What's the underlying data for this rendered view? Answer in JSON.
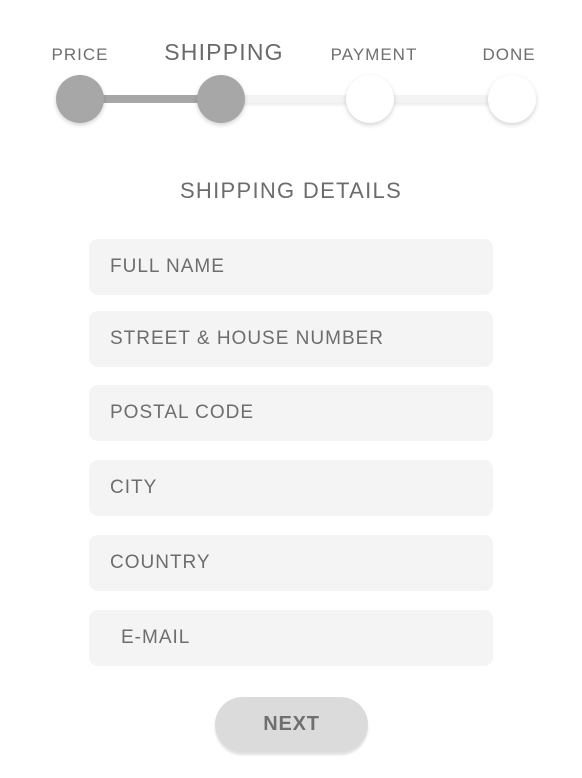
{
  "stepper": {
    "steps": [
      {
        "label": "PRICE",
        "state": "done"
      },
      {
        "label": "SHIPPING",
        "state": "current"
      },
      {
        "label": "PAYMENT",
        "state": "todo"
      },
      {
        "label": "DONE",
        "state": "todo"
      }
    ]
  },
  "form": {
    "title": "SHIPPING DETAILS",
    "fields": [
      {
        "placeholder": "FULL NAME"
      },
      {
        "placeholder": "STREET & HOUSE NUMBER"
      },
      {
        "placeholder": "POSTAL CODE"
      },
      {
        "placeholder": "CITY"
      },
      {
        "placeholder": "COUNTRY"
      },
      {
        "placeholder": "E-MAIL"
      }
    ],
    "next_label": "NEXT"
  },
  "colors": {
    "completed": "#a7a7a7",
    "field_background": "#f4f4f4",
    "button_background": "#dcdbdb",
    "text": "#6f6f6f"
  }
}
